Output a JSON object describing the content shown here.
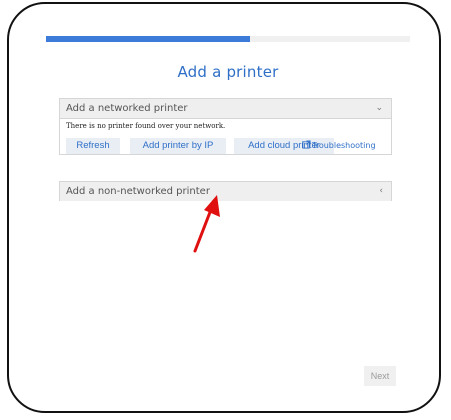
{
  "progress": {
    "value_fraction": 0.56
  },
  "title": "Add a printer",
  "networked_section": {
    "header": "Add a networked printer",
    "message": "There is no printer found over your network.",
    "buttons": {
      "refresh": "Refresh",
      "add_by_ip": "Add printer by IP",
      "add_cloud": "Add cloud printer"
    },
    "troubleshooting_link": "Troubleshooting"
  },
  "non_networked_section": {
    "header": "Add a non-networked printer"
  },
  "footer": {
    "next_label": "Next"
  },
  "colors": {
    "accent": "#3d7bd8",
    "title": "#2f6fc7",
    "annotation": "#e01010"
  },
  "icons": {
    "expanded": "chevron-down-icon",
    "collapsed": "chevron-left-icon",
    "external": "external-link-icon"
  }
}
